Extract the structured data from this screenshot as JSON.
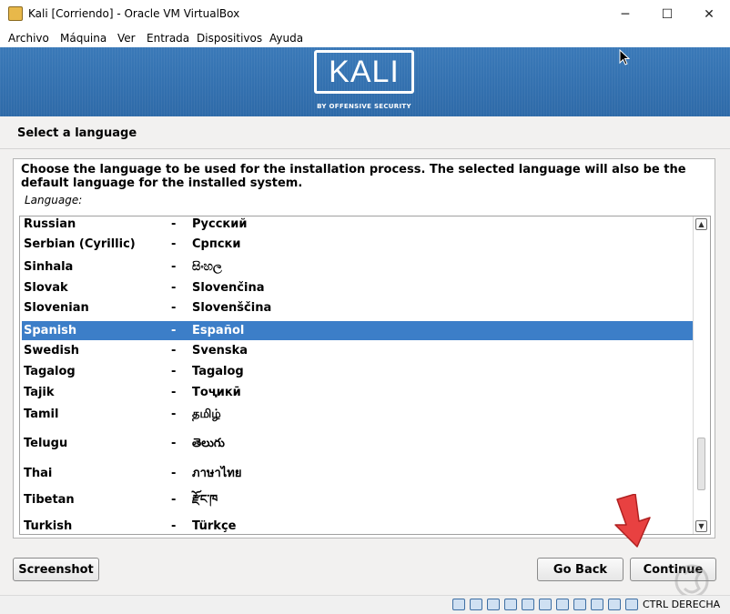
{
  "window": {
    "title": "Kali [Corriendo] - Oracle VM VirtualBox",
    "controls": {
      "minimize": "─",
      "maximize": "☐",
      "close": "✕"
    }
  },
  "menubar": {
    "items": [
      {
        "label": "Archivo"
      },
      {
        "label": "Máquina"
      },
      {
        "label": "Ver"
      },
      {
        "label": "Entrada"
      },
      {
        "label": "Dispositivos"
      },
      {
        "label": "Ayuda"
      }
    ]
  },
  "banner": {
    "logo": "KALI",
    "tagline": "BY OFFENSIVE SECURITY",
    "background_color": "#2f6aa8"
  },
  "installer": {
    "step_title": "Select a language",
    "description": "Choose the language to be used for the installation process. The selected language will also be the default language for the installed system.",
    "list_label": "Language:",
    "selected_color": "#3c7ec8",
    "languages": [
      {
        "name": "Russian",
        "sep": "-",
        "native": "Русский",
        "selected": false
      },
      {
        "name": "Serbian (Cyrillic)",
        "sep": "-",
        "native": "Српски",
        "selected": false
      },
      {
        "name": "Sinhala",
        "sep": "-",
        "native": "සිංහල",
        "selected": false
      },
      {
        "name": "Slovak",
        "sep": "-",
        "native": "Slovenčina",
        "selected": false
      },
      {
        "name": "Slovenian",
        "sep": "-",
        "native": "Slovenščina",
        "selected": false
      },
      {
        "name": "Spanish",
        "sep": "-",
        "native": "Español",
        "selected": true
      },
      {
        "name": "Swedish",
        "sep": "-",
        "native": "Svenska",
        "selected": false
      },
      {
        "name": "Tagalog",
        "sep": "-",
        "native": "Tagalog",
        "selected": false
      },
      {
        "name": "Tajik",
        "sep": "-",
        "native": "Тоҷикӣ",
        "selected": false
      },
      {
        "name": "Tamil",
        "sep": "-",
        "native": "தமிழ்",
        "selected": false
      },
      {
        "name": "Telugu",
        "sep": "-",
        "native": "తెలుగు",
        "selected": false
      },
      {
        "name": "Thai",
        "sep": "-",
        "native": "ภาษาไทย",
        "selected": false
      },
      {
        "name": "Tibetan",
        "sep": "-",
        "native": "རྫོང་ཁ",
        "selected": false
      },
      {
        "name": "Turkish",
        "sep": "-",
        "native": "Türkçe",
        "selected": false
      }
    ],
    "scroll_position": 0.88,
    "buttons": {
      "screenshot": "Screenshot",
      "go_back": "Go Back",
      "continue": "Continue"
    }
  },
  "statusbar": {
    "icons": [
      "hard-disk-icon",
      "optical-drive-icon",
      "audio-icon",
      "network-icon",
      "usb-icon",
      "shared-folder-icon",
      "display-icon",
      "video-capture-icon",
      "cpu-icon",
      "mouse-integration-icon",
      "keyboard-capture-icon"
    ],
    "host_key": "CTRL DERECHA"
  },
  "annotation": {
    "arrow_color": "#e84141"
  }
}
